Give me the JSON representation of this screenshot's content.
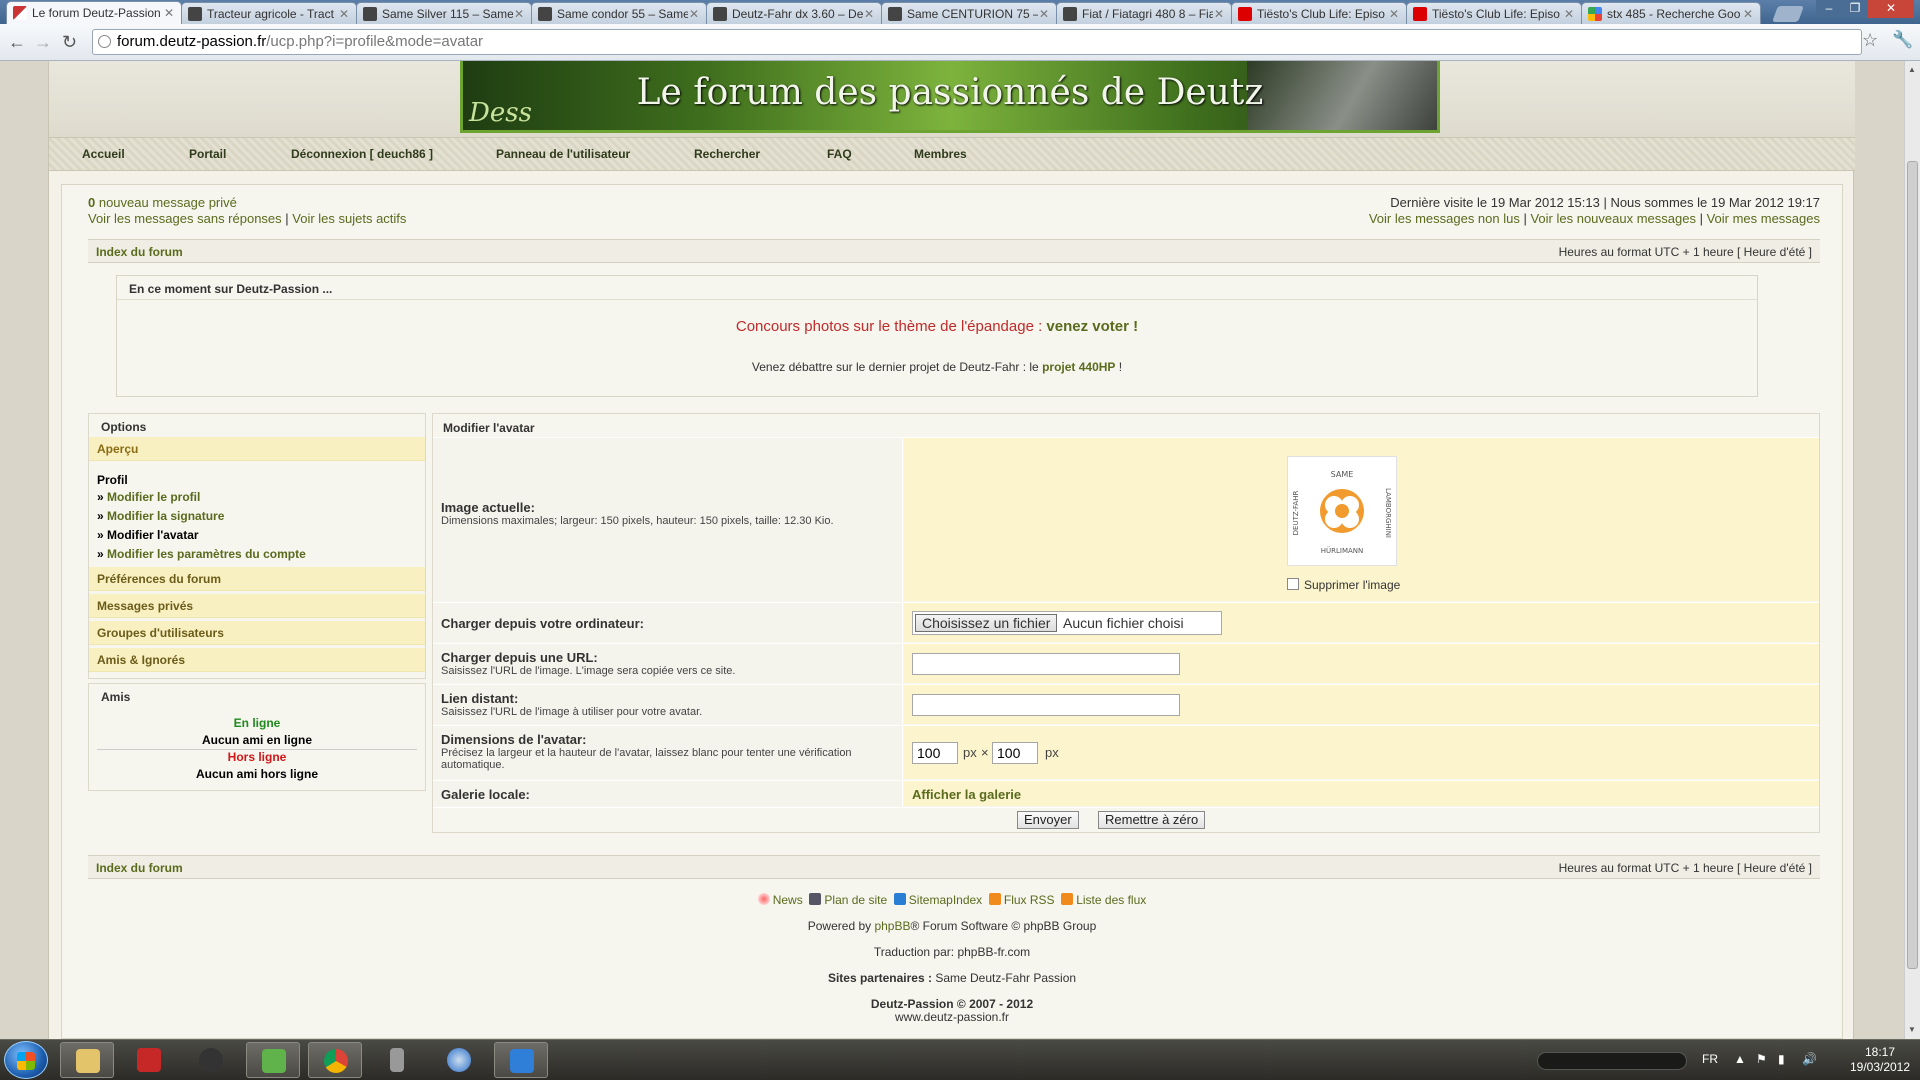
{
  "browser": {
    "tabs": [
      {
        "title": "Le forum Deutz-Passion",
        "icon": "deutz",
        "active": true
      },
      {
        "title": "Tracteur agricole - Tract",
        "icon": "tractor"
      },
      {
        "title": "Same Silver 115 – Same",
        "icon": "tractor"
      },
      {
        "title": "Same condor 55 – Same",
        "icon": "tractor"
      },
      {
        "title": "Deutz-Fahr dx 3.60 – De",
        "icon": "tractor"
      },
      {
        "title": "Same CENTURION 75 –",
        "icon": "tractor"
      },
      {
        "title": "Fiat / Fiatagri 480 8 – Fia",
        "icon": "tractor"
      },
      {
        "title": "Tiësto's Club Life: Episo",
        "icon": "yt"
      },
      {
        "title": "Tiësto's Club Life: Episo",
        "icon": "yt"
      },
      {
        "title": "stx 485 - Recherche Goo",
        "icon": "g"
      }
    ],
    "url_host": "forum.deutz-passion.fr",
    "url_path": "/ucp.php?i=profile&mode=avatar"
  },
  "banner": {
    "title": "Le forum des passionnés de Deutz",
    "deco_text": "Dess"
  },
  "nav": {
    "items": [
      "Accueil",
      "Portail",
      "Déconnexion [ deuch86 ]",
      "Panneau de l'utilisateur",
      "Rechercher",
      "FAQ",
      "Membres"
    ]
  },
  "topinfo": {
    "pm_count": "0",
    "pm_text": " nouveau message privé",
    "link_unanswered": "Voir les messages sans réponses",
    "link_active": "Voir les sujets actifs",
    "sep": " | ",
    "last_visit": "Dernière visite le 19 Mar 2012 15:13 | Nous sommes le 19 Mar 2012 19:17",
    "link_unread": "Voir les messages non lus",
    "link_new": "Voir les nouveaux messages",
    "link_mine": "Voir mes messages"
  },
  "breadcrumb": {
    "index": "Index du forum",
    "timezone": "Heures au format UTC + 1 heure [ Heure d'été ]"
  },
  "announce": {
    "header": "En ce moment sur Deutz-Passion ...",
    "line1_text": "Concours photos sur le thème de l'épandage : ",
    "line1_link": "venez voter !",
    "line2_text": "Venez débattre sur le dernier projet de Deutz-Fahr : le ",
    "line2_link": "projet 440HP",
    "line2_end": " !"
  },
  "sidebar": {
    "options_title": "Options",
    "apercu": "Aperçu",
    "profil_title": "Profil",
    "profil_items": [
      "Modifier le profil",
      "Modifier la signature",
      "Modifier l'avatar",
      "Modifier les paramètres du compte"
    ],
    "sections": [
      "Préférences du forum",
      "Messages privés",
      "Groupes d'utilisateurs",
      "Amis & Ignorés"
    ],
    "friends_title": "Amis",
    "online_label": "En ligne",
    "online_none": "Aucun ami en ligne",
    "offline_label": "Hors ligne",
    "offline_none": "Aucun ami hors ligne"
  },
  "form": {
    "title": "Modifier l'avatar",
    "current_label": "Image actuelle:",
    "current_desc": "Dimensions maximales; largeur: 150 pixels, hauteur: 150 pixels, taille: 12.30 Kio.",
    "avatar_top_text": "SAME",
    "avatar_left_text": "DEUTZ-FAHR",
    "avatar_right_text": "LAMBORGHINI",
    "avatar_bottom_text": "HÜRLIMANN",
    "delete_label": "Supprimer l'image",
    "upload_label": "Charger depuis votre ordinateur:",
    "file_button": "Choisissez un fichier",
    "file_none": "Aucun fichier choisi",
    "url_label": "Charger depuis une URL:",
    "url_desc": "Saisissez l'URL de l'image. L'image sera copiée vers ce site.",
    "url_value": "",
    "remote_label": "Lien distant:",
    "remote_desc": "Saisissez l'URL de l'image à utiliser pour votre avatar.",
    "remote_value": "",
    "dims_label": "Dimensions de l'avatar:",
    "dims_desc": "Précisez la largeur et la hauteur de l'avatar, laissez blanc pour tenter une vérification automatique.",
    "width_value": "100",
    "height_value": "100",
    "px_unit": "px",
    "times": "×",
    "gallery_label": "Galerie locale:",
    "gallery_link": "Afficher la galerie",
    "submit": "Envoyer",
    "reset": "Remettre à zéro"
  },
  "footer": {
    "links": [
      "News",
      "Plan de site",
      "SitemapIndex",
      "Flux RSS",
      "Liste des flux"
    ],
    "powered_pre": "Powered by ",
    "powered_link": "phpBB",
    "powered_post": "® Forum Software © phpBB Group",
    "translation": "Traduction par: phpBB-fr.com",
    "partners_label": "Sites partenaires :",
    "partners_value": " Same Deutz-Fahr Passion",
    "copyright": "Deutz-Passion © 2007 - 2012",
    "site": "www.deutz-passion.fr"
  },
  "taskbar": {
    "lang": "FR",
    "time": "18:17",
    "date": "19/03/2012"
  },
  "colors": {
    "olive_link": "#5a6b1e",
    "highlight_row": "#fbf4cc",
    "sidebar_item": "#f8f0c0",
    "online": "#1f8a1f",
    "offline": "#d01818",
    "announce_red": "#c02a2a"
  }
}
